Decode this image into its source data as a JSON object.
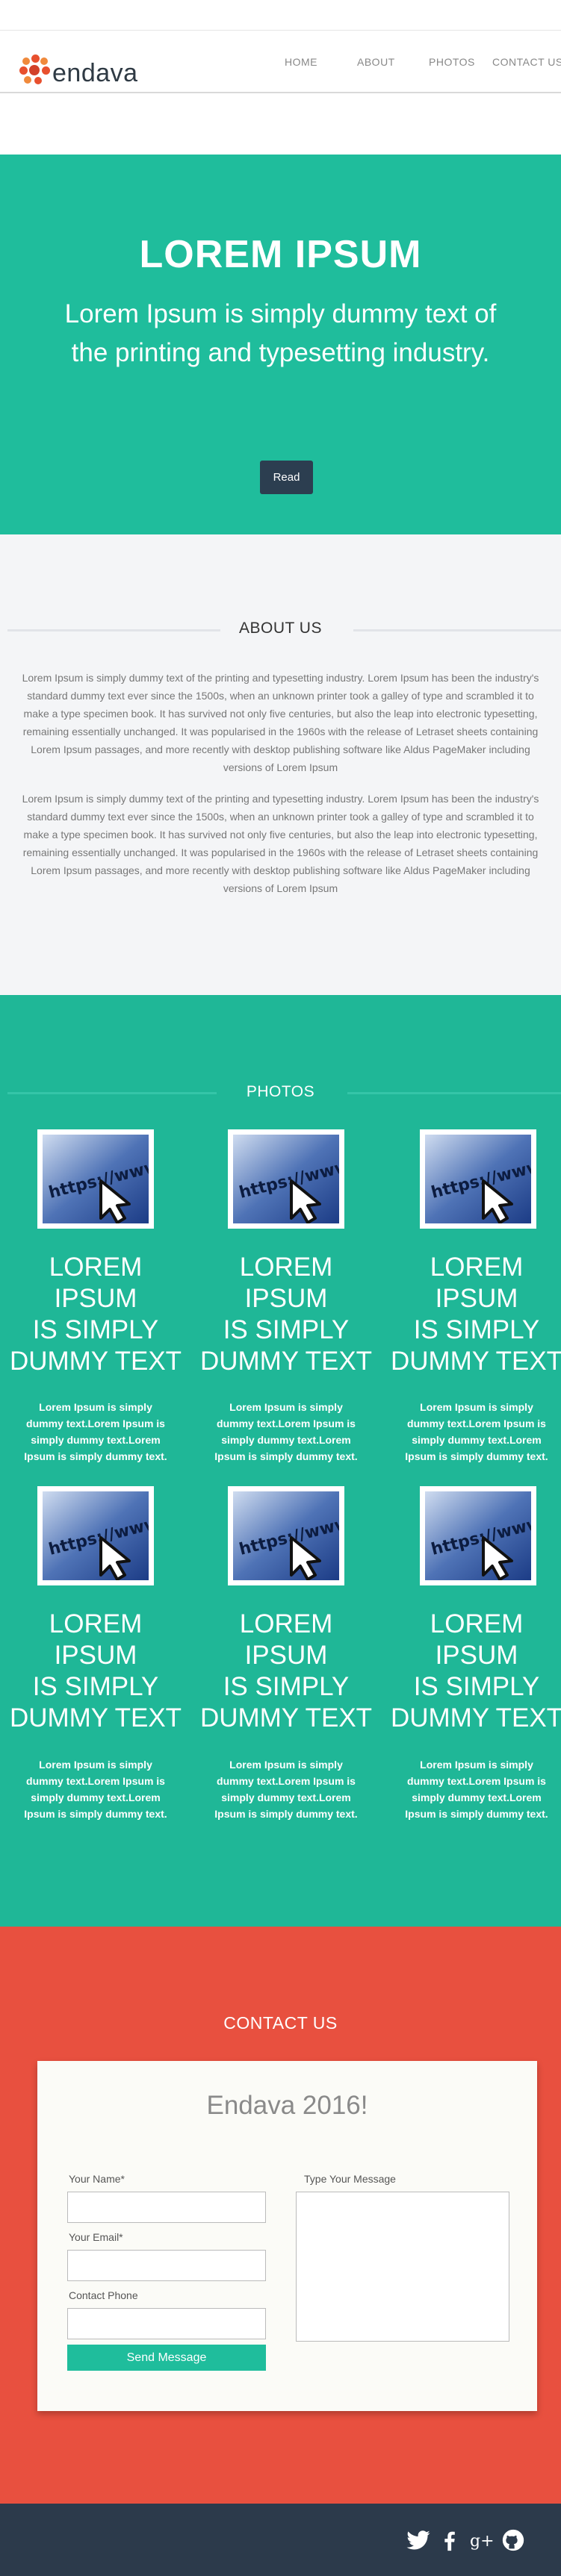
{
  "brand": {
    "name": "endava"
  },
  "nav": {
    "items": [
      "HOME",
      "ABOUT",
      "PHOTOS",
      "CONTACT US"
    ]
  },
  "hero": {
    "title": "LOREM IPSUM",
    "subtitle": "Lorem Ipsum is simply dummy text of the printing and typesetting industry.",
    "button": "Read"
  },
  "about": {
    "title": "ABOUT US",
    "paragraphs": [
      "Lorem Ipsum is simply dummy text of the printing and typesetting industry. Lorem Ipsum has been the industry's standard dummy text ever since the 1500s, when an unknown printer took a galley of type and scrambled it to make a type specimen book. It has survived not only five centuries, but also the leap into electronic typesetting, remaining essentially unchanged. It was popularised in the 1960s with the release of Letraset sheets containing Lorem Ipsum passages, and more recently with desktop publishing software like Aldus PageMaker including versions of Lorem Ipsum",
      "Lorem Ipsum is simply dummy text of the printing and typesetting industry. Lorem Ipsum has been the industry's standard dummy text ever since the 1500s, when an unknown printer took a galley of type and scrambled it to make a type specimen book. It has survived not only five centuries, but also the leap into electronic typesetting, remaining essentially unchanged. It was popularised in the 1960s with the release of Letraset sheets containing Lorem Ipsum passages, and more recently with desktop publishing software like Aldus PageMaker including versions of Lorem Ipsum"
    ]
  },
  "photos": {
    "title": "PHOTOS",
    "image_text": "https://www",
    "items": [
      {
        "title": "LOREM\nIPSUM\nIS SIMPLY\nDUMMY TEXT",
        "text": "Lorem Ipsum is simply dummy text.Lorem Ipsum is simply dummy text.Lorem Ipsum is simply dummy text."
      },
      {
        "title": "LOREM\nIPSUM\nIS SIMPLY\nDUMMY TEXT",
        "text": "Lorem Ipsum is simply dummy text.Lorem Ipsum is simply dummy text.Lorem Ipsum is simply dummy text."
      },
      {
        "title": "LOREM\nIPSUM\nIS SIMPLY\nDUMMY TEXT",
        "text": "Lorem Ipsum is simply dummy text.Lorem Ipsum is simply dummy text.Lorem Ipsum is simply dummy text."
      },
      {
        "title": "LOREM\nIPSUM\nIS SIMPLY\nDUMMY TEXT",
        "text": "Lorem Ipsum is simply dummy text.Lorem Ipsum is simply dummy text.Lorem Ipsum is simply dummy text."
      },
      {
        "title": "LOREM\nIPSUM\nIS SIMPLY\nDUMMY TEXT",
        "text": "Lorem Ipsum is simply dummy text.Lorem Ipsum is simply dummy text.Lorem Ipsum is simply dummy text."
      },
      {
        "title": "LOREM\nIPSUM\nIS SIMPLY\nDUMMY TEXT",
        "text": "Lorem Ipsum is simply dummy text.Lorem Ipsum is simply dummy text.Lorem Ipsum is simply dummy text."
      }
    ]
  },
  "contact": {
    "title": "CONTACT US",
    "form_title": "Endava 2016!",
    "name_label": "Your Name*",
    "email_label": "Your Email*",
    "phone_label": "Contact Phone",
    "message_label": "Type Your Message",
    "name_value": "",
    "email_value": "",
    "phone_value": "",
    "message_value": "",
    "send_label": "Send Message"
  },
  "footer": {
    "social_icons": [
      "twitter-icon",
      "facebook-icon",
      "google-plus-icon",
      "github-icon"
    ],
    "google_plus_glyph": "g+"
  },
  "colors": {
    "teal": "#1fbd9c",
    "teal_dark": "#1fb797",
    "navy": "#2c3e50",
    "red": "#e8503f",
    "footer": "#2c3a4b",
    "logo_orange": "#e8502e"
  }
}
